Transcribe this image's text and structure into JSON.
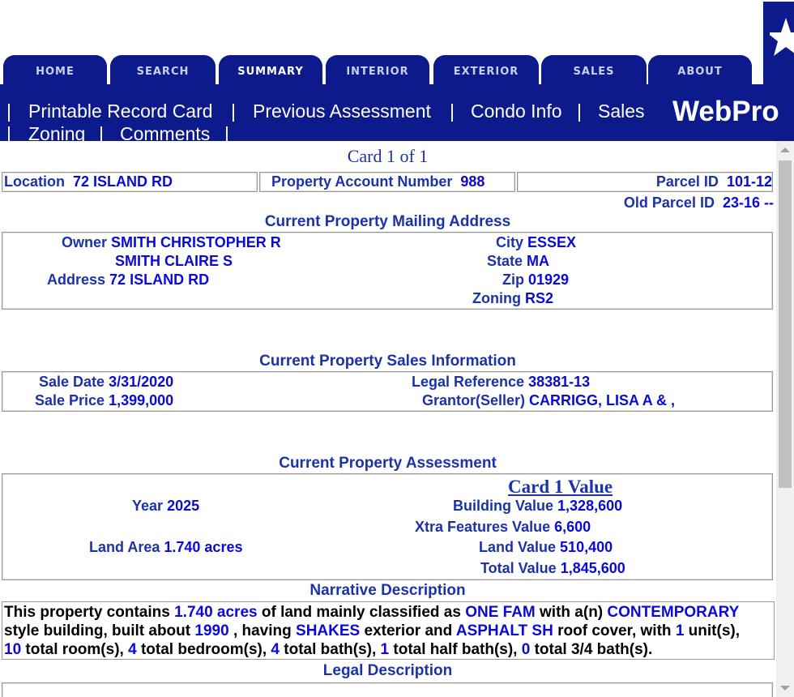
{
  "tabs": [
    "HOME",
    "SEARCH",
    "SUMMARY",
    "INTERIOR",
    "EXTERIOR",
    "SALES",
    "ABOUT"
  ],
  "active_tab": "SUMMARY",
  "subnav": {
    "printable": "Printable Record Card",
    "previous": "Previous Assessment",
    "condo": "Condo Info",
    "sales": "Sales",
    "zoning": "Zoning",
    "comments": "Comments",
    "brand": "WebPro"
  },
  "card_of": "Card 1 of 1",
  "header": {
    "location_label": "Location",
    "location": "72 ISLAND RD",
    "account_label": "Property Account Number",
    "account": "988",
    "parcel_label": "Parcel ID",
    "parcel": "101-12",
    "old_parcel_label": "Old Parcel ID",
    "old_parcel": "23-16 --"
  },
  "mailing": {
    "title": "Current Property Mailing Address",
    "owner_label": "Owner",
    "owner1": "SMITH CHRISTOPHER R",
    "owner2": "SMITH CLAIRE S",
    "address_label": "Address",
    "address": "72 ISLAND RD",
    "city_label": "City",
    "city": "ESSEX",
    "state_label": "State",
    "state": "MA",
    "zip_label": "Zip",
    "zip": "01929",
    "zoning_label": "Zoning",
    "zoning": "RS2"
  },
  "sales": {
    "title": "Current Property Sales Information",
    "date_label": "Sale Date",
    "date": "3/31/2020",
    "price_label": "Sale Price",
    "price": "1,399,000",
    "legal_label": "Legal Reference",
    "legal": "38381-13",
    "grantor_label": "Grantor(Seller)",
    "grantor": "CARRIGG, LISA A & ,"
  },
  "assessment": {
    "title": "Current Property Assessment",
    "card_value": "Card 1 Value",
    "year_label": "Year",
    "year": "2025",
    "land_area_label": "Land Area",
    "land_area": "1.740 acres",
    "building_label": "Building Value",
    "building": "1,328,600",
    "xtra_label": "Xtra Features Value",
    "xtra": "6,600",
    "land_label": "Land Value",
    "land": "510,400",
    "total_label": "Total Value",
    "total": "1,845,600"
  },
  "narrative": {
    "title": "Narrative Description",
    "t1": "This property contains ",
    "acres": "1.740 acres",
    "t2": " of land mainly classified as ",
    "class": "ONE FAM",
    "t3": " with a(n) ",
    "style": "CONTEMPORARY",
    "t4": "style building, built about ",
    "year": "1990",
    "t5": " , having ",
    "exterior": "SHAKES",
    "t6": " exterior and ",
    "roof": "ASPHALT SH",
    "t7": " roof cover, with ",
    "units": "1",
    "t8": " unit(s),",
    "rooms": "10",
    "t9": " total room(s), ",
    "beds": "4",
    "t10": " total bedroom(s), ",
    "baths": "4",
    "t11": " total bath(s), ",
    "half": "1",
    "t12": " total half bath(s), ",
    "three_q": "0",
    "t13": " total 3/4 bath(s)."
  },
  "legal_title": "Legal Description"
}
